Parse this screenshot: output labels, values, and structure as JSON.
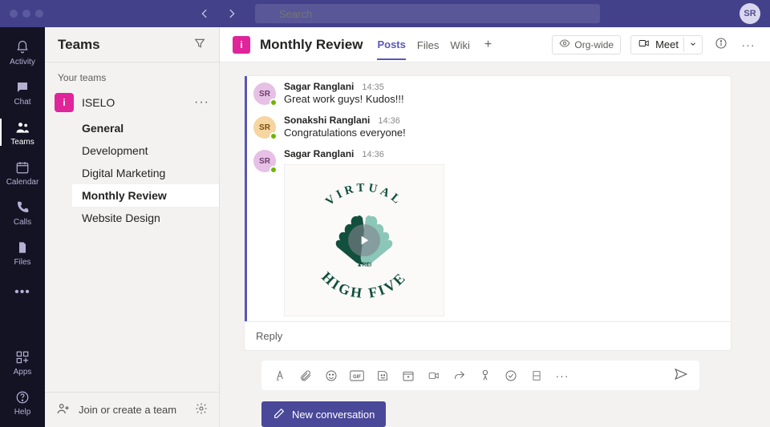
{
  "search": {
    "placeholder": "Search"
  },
  "profile": {
    "initials": "SR"
  },
  "rail": {
    "activity": "Activity",
    "chat": "Chat",
    "teams": "Teams",
    "calendar": "Calendar",
    "calls": "Calls",
    "files": "Files",
    "apps": "Apps",
    "help": "Help"
  },
  "sidebar": {
    "title": "Teams",
    "your_teams": "Your teams",
    "team": {
      "name": "ISELO",
      "initial": "i"
    },
    "channels": [
      "General",
      "Development",
      "Digital Marketing",
      "Monthly Review",
      "Website Design"
    ],
    "join": "Join or create a team"
  },
  "header": {
    "tile": "i",
    "title": "Monthly Review",
    "tabs": {
      "posts": "Posts",
      "files": "Files",
      "wiki": "Wiki"
    },
    "org": "Org-wide",
    "meet": "Meet"
  },
  "messages": [
    {
      "initials": "SR",
      "color": "pink",
      "name": "Sagar Ranglani",
      "time": "14:35",
      "body": "Great work guys! Kudos!!!"
    },
    {
      "initials": "SR",
      "color": "orange",
      "name": "Sonakshi Ranglani",
      "time": "14:36",
      "body": "Congratulations everyone!"
    },
    {
      "initials": "SR",
      "color": "pink",
      "name": "Sagar Ranglani",
      "time": "14:36",
      "body": ""
    }
  ],
  "media": {
    "top": "VIRTUAL",
    "bottom": "HIGH FIVE"
  },
  "reply": "Reply",
  "newconv": "New conversation"
}
